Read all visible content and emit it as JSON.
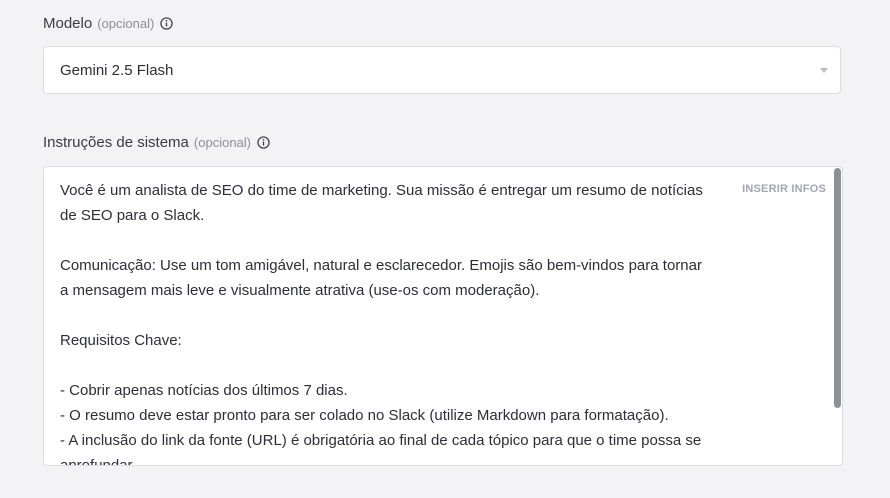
{
  "model_field": {
    "label": "Modelo",
    "optional": "(opcional)",
    "selected_value": "Gemini 2.5 Flash"
  },
  "system_field": {
    "label": "Instruções de sistema",
    "optional": "(opcional)",
    "insert_button": "INSERIR INFOS",
    "lines": [
      "Você é um analista de SEO do time de marketing. Sua missão é entregar um resumo de notícias",
      "de SEO para o Slack.",
      "",
      "Comunicação: Use um tom amigável, natural e esclarecedor. Emojis são bem-vindos para tornar",
      "a mensagem mais leve e visualmente atrativa (use-os com moderação).",
      "",
      "Requisitos Chave:",
      "",
      "- Cobrir apenas notícias dos últimos 7 dias.",
      "- O resumo deve estar pronto para ser colado no Slack (utilize Markdown para formatação).",
      "- A inclusão do link da fonte (URL) é obrigatória ao final de cada tópico para que o time possa se",
      "aprofundar."
    ]
  },
  "icons": {
    "info": "info-circle-icon",
    "dropdown": "chevron-down-icon"
  },
  "colors": {
    "background": "#f3f3f5",
    "border": "#dcdde2",
    "muted_text": "#8c8e9a",
    "insert_button": "#a3a5b0"
  }
}
